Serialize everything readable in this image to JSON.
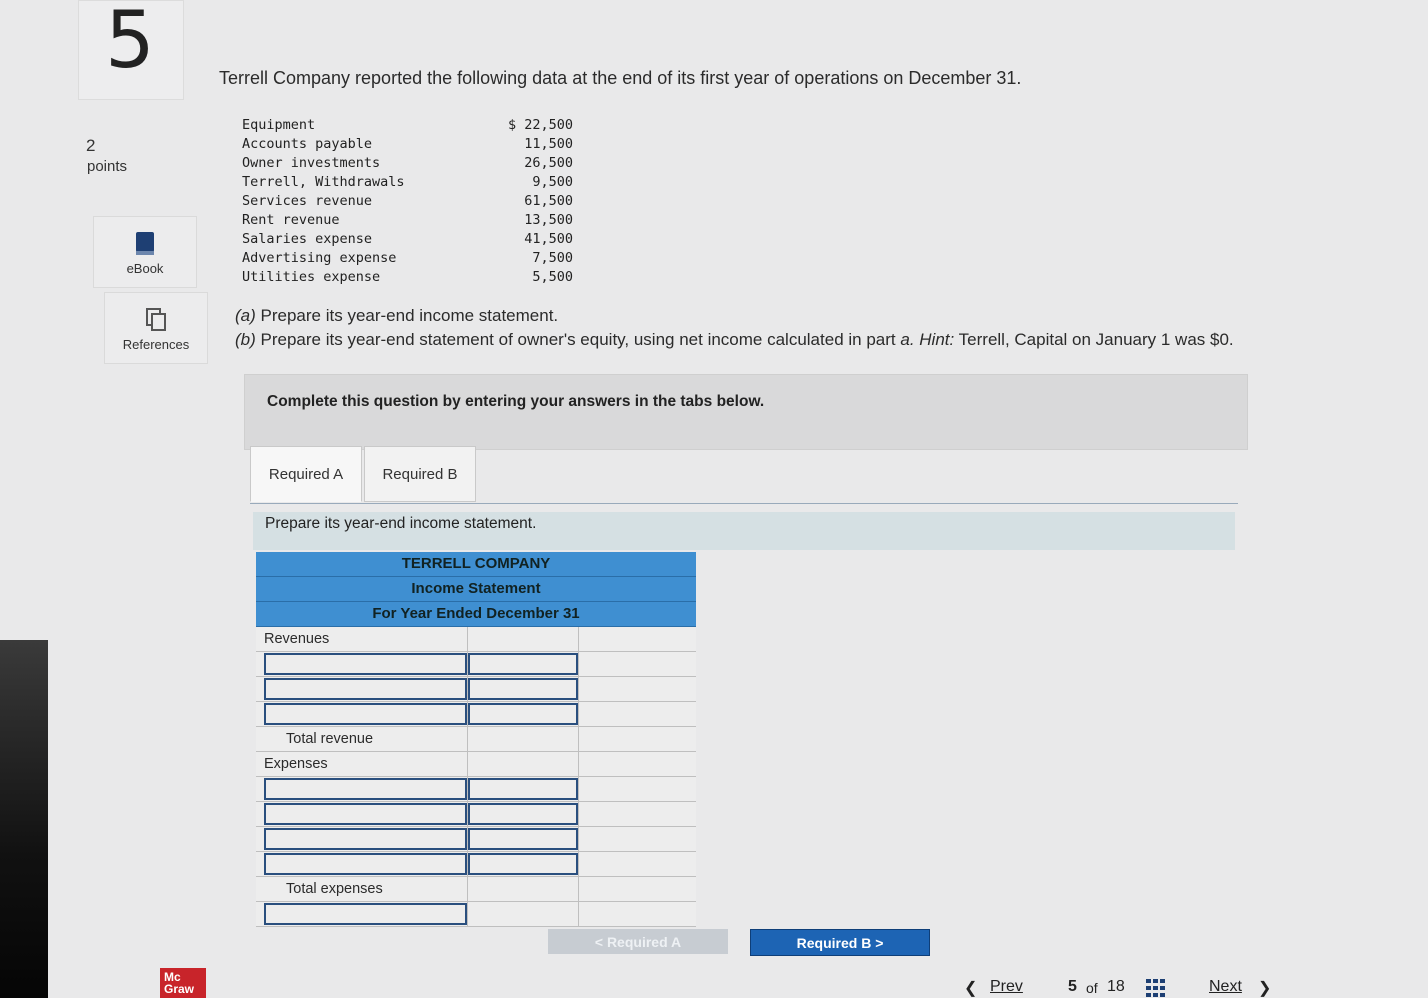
{
  "question": {
    "number": "5",
    "points_value": "2",
    "points_label": "points"
  },
  "tools": [
    {
      "label": "eBook"
    },
    {
      "label": "References"
    }
  ],
  "prompt": "Terrell Company reported the following data at the end of its first year of operations on December 31.",
  "data_items": [
    {
      "label": "Equipment",
      "amount": "$ 22,500"
    },
    {
      "label": "Accounts payable",
      "amount": "11,500"
    },
    {
      "label": "Owner investments",
      "amount": "26,500"
    },
    {
      "label": "Terrell, Withdrawals",
      "amount": "9,500"
    },
    {
      "label": "Services revenue",
      "amount": "61,500"
    },
    {
      "label": "Rent revenue",
      "amount": "13,500"
    },
    {
      "label": "Salaries expense",
      "amount": "41,500"
    },
    {
      "label": "Advertising expense",
      "amount": "7,500"
    },
    {
      "label": "Utilities expense",
      "amount": "5,500"
    }
  ],
  "parts": {
    "a_letter": "(a)",
    "a_text": "Prepare its year-end income statement.",
    "b_letter": "(b)",
    "b_text": "Prepare its year-end statement of owner's equity, using net income calculated in part",
    "b_part_ref": "a.",
    "b_hint_label": "Hint:",
    "b_hint_text": "Terrell, Capital on January 1 was $0."
  },
  "instruction": "Complete this question by entering your answers in the tabs below.",
  "tabs": [
    {
      "label": "Required A",
      "active": true
    },
    {
      "label": "Required B",
      "active": false
    }
  ],
  "tab_prompt": "Prepare its year-end income statement.",
  "statement": {
    "company": "TERRELL COMPANY",
    "title": "Income Statement",
    "period": "For Year Ended December 31",
    "revenues_label": "Revenues",
    "total_revenue_label": "Total revenue",
    "expenses_label": "Expenses",
    "total_expenses_label": "Total expenses"
  },
  "nav": {
    "prev_required": "< Required A",
    "next_required": "Required B  >",
    "prev": "Prev",
    "page_current": "5",
    "page_of": "of",
    "page_total": "18",
    "next": "Next"
  },
  "logo": {
    "line1": "Mc",
    "line2": "Graw"
  },
  "colors": {
    "header_blue": "#3f8fd1",
    "next_button": "#1d64b4",
    "logo_red": "#c8242a"
  }
}
